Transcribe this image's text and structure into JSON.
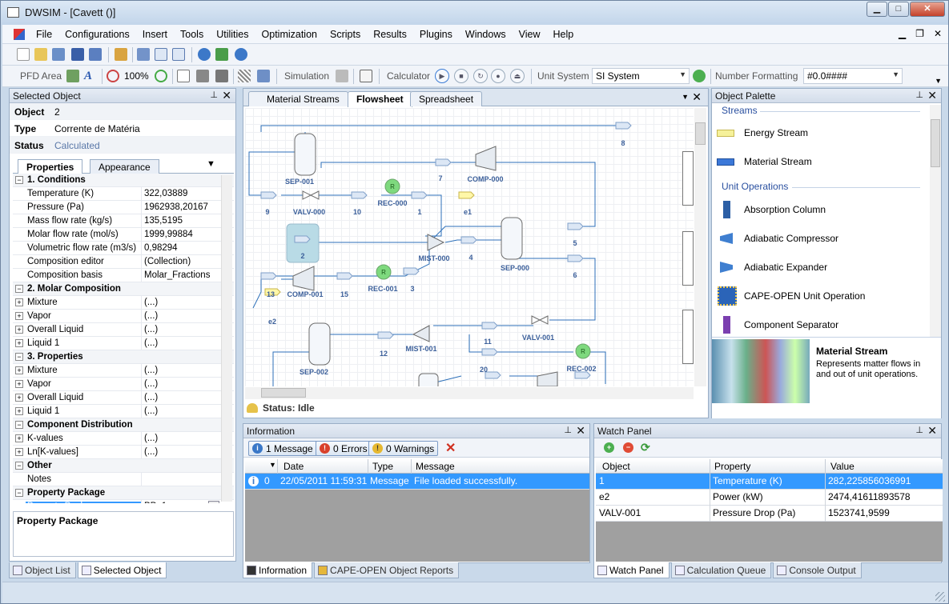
{
  "window": {
    "title": "DWSIM - [Cavett ()]"
  },
  "menu": [
    "File",
    "Configurations",
    "Insert",
    "Tools",
    "Utilities",
    "Optimization",
    "Scripts",
    "Results",
    "Plugins",
    "Windows",
    "View",
    "Help"
  ],
  "toolbar2": {
    "pfd_area": "PFD Area",
    "zoom": "100%",
    "simulation": "Simulation",
    "calculator": "Calculator",
    "unit_system_label": "Unit System",
    "unit_system_value": "SI System",
    "number_formatting_label": "Number Formatting",
    "number_formatting_value": "#0.0####"
  },
  "selected_object": {
    "panel_title": "Selected Object",
    "object_label": "Object",
    "object_value": "2",
    "type_label": "Type",
    "type_value": "Corrente de Matéria",
    "status_label": "Status",
    "status_value": "Calculated",
    "tabs": [
      "Properties",
      "Appearance"
    ],
    "rows": [
      {
        "kind": "cat",
        "name": "1. Conditions"
      },
      {
        "name": "Temperature (K)",
        "value": "322,03889"
      },
      {
        "name": "Pressure (Pa)",
        "value": "1962938,20167"
      },
      {
        "name": "Mass flow rate (kg/s)",
        "value": "135,5195"
      },
      {
        "name": "Molar flow rate (mol/s)",
        "value": "1999,99884"
      },
      {
        "name": "Volumetric flow rate (m3/s)",
        "value": "0,98294"
      },
      {
        "name": "Composition editor",
        "value": "(Collection)"
      },
      {
        "name": "Composition basis",
        "value": "Molar_Fractions"
      },
      {
        "kind": "cat",
        "name": "2. Molar Composition"
      },
      {
        "exp": true,
        "name": "Mixture",
        "value": "(...)"
      },
      {
        "exp": true,
        "name": "Vapor",
        "value": "(...)"
      },
      {
        "exp": true,
        "name": "Overall Liquid",
        "value": "(...)"
      },
      {
        "exp": true,
        "name": "Liquid 1",
        "value": "(...)"
      },
      {
        "kind": "cat",
        "name": "3. Properties"
      },
      {
        "exp": true,
        "name": "Mixture",
        "value": "(...)"
      },
      {
        "exp": true,
        "name": "Vapor",
        "value": "(...)"
      },
      {
        "exp": true,
        "name": "Overall Liquid",
        "value": "(...)"
      },
      {
        "exp": true,
        "name": "Liquid 1",
        "value": "(...)"
      },
      {
        "kind": "cat",
        "name": "Component Distribution"
      },
      {
        "exp": true,
        "name": "K-values",
        "value": "(...)"
      },
      {
        "exp": true,
        "name": "Ln[K-values]",
        "value": "(...)"
      },
      {
        "kind": "cat",
        "name": "Other"
      },
      {
        "name": "Notes",
        "value": ""
      },
      {
        "kind": "cat",
        "name": "Property Package"
      },
      {
        "sel": true,
        "name": "Property Package",
        "value": "PP_1"
      }
    ],
    "description_title": "Property Package",
    "bottom_tabs": [
      "Object List",
      "Selected Object"
    ]
  },
  "flowsheet": {
    "tabs": [
      "Material Streams",
      "Flowsheet",
      "Spreadsheet"
    ],
    "status": "Status: Idle",
    "labels": [
      "SEP-001",
      "COMP-000",
      "VALV-000",
      "REC-000",
      "SEP-000",
      "MIST-000",
      "COMP-001",
      "REC-001",
      "VALV-001",
      "MIST-001",
      "SEP-002",
      "REC-002",
      "8",
      "7",
      "9",
      "10",
      "1",
      "e1",
      "5",
      "6",
      "2",
      "4",
      "13",
      "15",
      "3",
      "e2",
      "12",
      "11",
      "20"
    ]
  },
  "palette": {
    "title": "Object Palette",
    "streams_header": "Streams",
    "streams": [
      "Energy Stream",
      "Material Stream"
    ],
    "unitops_header": "Unit Operations",
    "unitops": [
      "Absorption Column",
      "Adiabatic Compressor",
      "Adiabatic Expander",
      "CAPE-OPEN Unit Operation",
      "Component Separator"
    ],
    "desc_title": "Material Stream",
    "desc_text": "Represents matter flows in and out of unit operations."
  },
  "information": {
    "title": "Information",
    "messages_btn": "1 Message",
    "errors_btn": "0 Errors",
    "warnings_btn": "0 Warnings",
    "columns": [
      "Date",
      "Type",
      "Message"
    ],
    "rows": [
      {
        "num": "0",
        "date": "22/05/2011 11:59:31",
        "type": "Message",
        "message": "File  loaded successfully."
      }
    ],
    "bottom_tabs": [
      "Information",
      "CAPE-OPEN Object Reports"
    ]
  },
  "watch": {
    "title": "Watch Panel",
    "columns": [
      "Object",
      "Property",
      "Value"
    ],
    "rows": [
      {
        "object": "1",
        "property": "Temperature (K)",
        "value": "282,225856036991"
      },
      {
        "object": "e2",
        "property": "Power (kW)",
        "value": "2474,41611893578"
      },
      {
        "object": "VALV-001",
        "property": "Pressure Drop (Pa)",
        "value": "1523741,9599"
      }
    ],
    "bottom_tabs": [
      "Watch Panel",
      "Calculation Queue",
      "Console Output"
    ]
  }
}
